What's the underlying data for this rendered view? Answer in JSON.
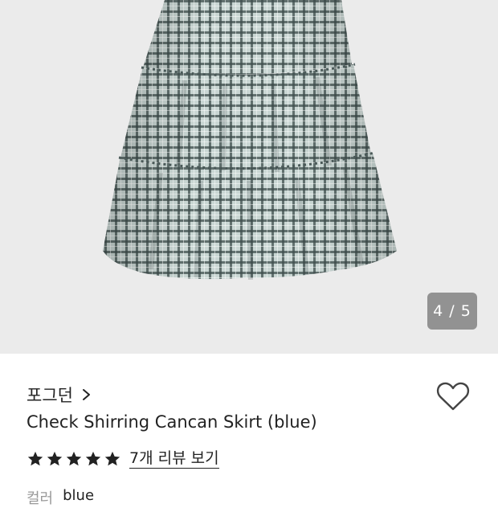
{
  "gallery": {
    "image_subject": "skirt-photo",
    "page_indicator": "4 / 5",
    "current_page": 4,
    "total_pages": 5
  },
  "product": {
    "brand": "포그던",
    "title": "Check Shirring Cancan Skirt (blue)",
    "rating_stars": 5,
    "review_link": "7개 리뷰 보기",
    "color_label": "컬러",
    "color_value": "blue"
  },
  "icons": {
    "brand_chevron": "chevron-right-icon",
    "wishlist": "heart-outline-icon",
    "star": "star-filled-icon"
  },
  "colors": {
    "gallery_bg": "#ebebeb",
    "text": "#222222",
    "muted": "#999999",
    "indicator_bg": "#787878"
  }
}
